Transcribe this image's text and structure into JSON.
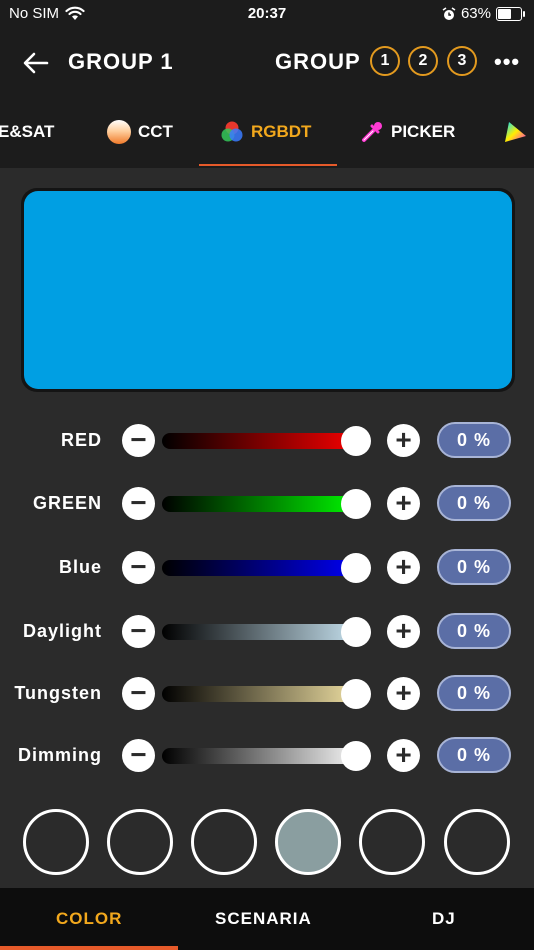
{
  "status_bar": {
    "carrier": "No SIM",
    "time": "20:37",
    "battery": "63%",
    "battery_level": 0.63
  },
  "header": {
    "title": "GROUP 1",
    "group_label": "GROUP",
    "groups": [
      "1",
      "2",
      "3"
    ],
    "more": "•••",
    "accent_color": "#e39a1f"
  },
  "tabs": [
    {
      "label": "E&SAT",
      "icon": "hue-sat-icon"
    },
    {
      "label": "CCT",
      "icon": "cct-icon"
    },
    {
      "label": "RGBDT",
      "icon": "rgb-circles-icon",
      "active": true
    },
    {
      "label": "PICKER",
      "icon": "color-picker-icon"
    },
    {
      "label": "",
      "icon": "triangle-gamut-icon"
    }
  ],
  "preview": {
    "color": "#009fe3"
  },
  "sliders": [
    {
      "label": "RED",
      "value": "0 %",
      "level": 1.0,
      "track": "linear-gradient(to right,#000,#ff0000)"
    },
    {
      "label": "GREEN",
      "value": "0 %",
      "level": 1.0,
      "track": "linear-gradient(to right,#000,#00ff00)"
    },
    {
      "label": "Blue",
      "value": "0 %",
      "level": 1.0,
      "track": "linear-gradient(to right,#000,#0000ff)"
    },
    {
      "label": "Daylight",
      "value": "0 %",
      "level": 1.0,
      "track": "linear-gradient(to right,#000,#cde9f7)"
    },
    {
      "label": "Tungsten",
      "value": "0 %",
      "level": 1.0,
      "track": "linear-gradient(to right,#000,#f7e7a8)"
    },
    {
      "label": "Dimming",
      "value": "0 %",
      "level": 1.0,
      "track": "linear-gradient(to right,#000,#ffffff)"
    }
  ],
  "presets": [
    {
      "color": "transparent"
    },
    {
      "color": "transparent"
    },
    {
      "color": "transparent"
    },
    {
      "color": "#8a9ea0"
    },
    {
      "color": "transparent"
    },
    {
      "color": "transparent"
    }
  ],
  "bottom_nav": [
    {
      "label": "COLOR",
      "active": true
    },
    {
      "label": "SCENARIA"
    },
    {
      "label": "DJ"
    }
  ]
}
